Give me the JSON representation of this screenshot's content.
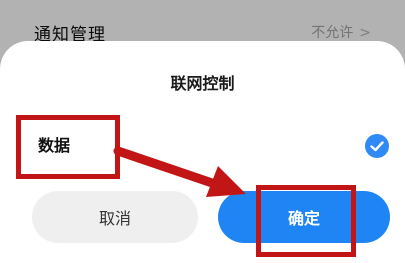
{
  "background": {
    "title": "通知管理",
    "value": "不允许",
    "chevron": ">"
  },
  "dialog": {
    "title": "联网控制",
    "option": {
      "label": "数据",
      "checked": true,
      "icon": "checkmark-icon"
    },
    "buttons": {
      "cancel": "取消",
      "confirm": "确定"
    }
  },
  "annotation": {
    "color": "#c21616",
    "targets": [
      "数据",
      "确定"
    ]
  },
  "colors": {
    "accent": "#1f85f5",
    "check": "#2f8af5",
    "cancel_bg": "#efefef"
  }
}
